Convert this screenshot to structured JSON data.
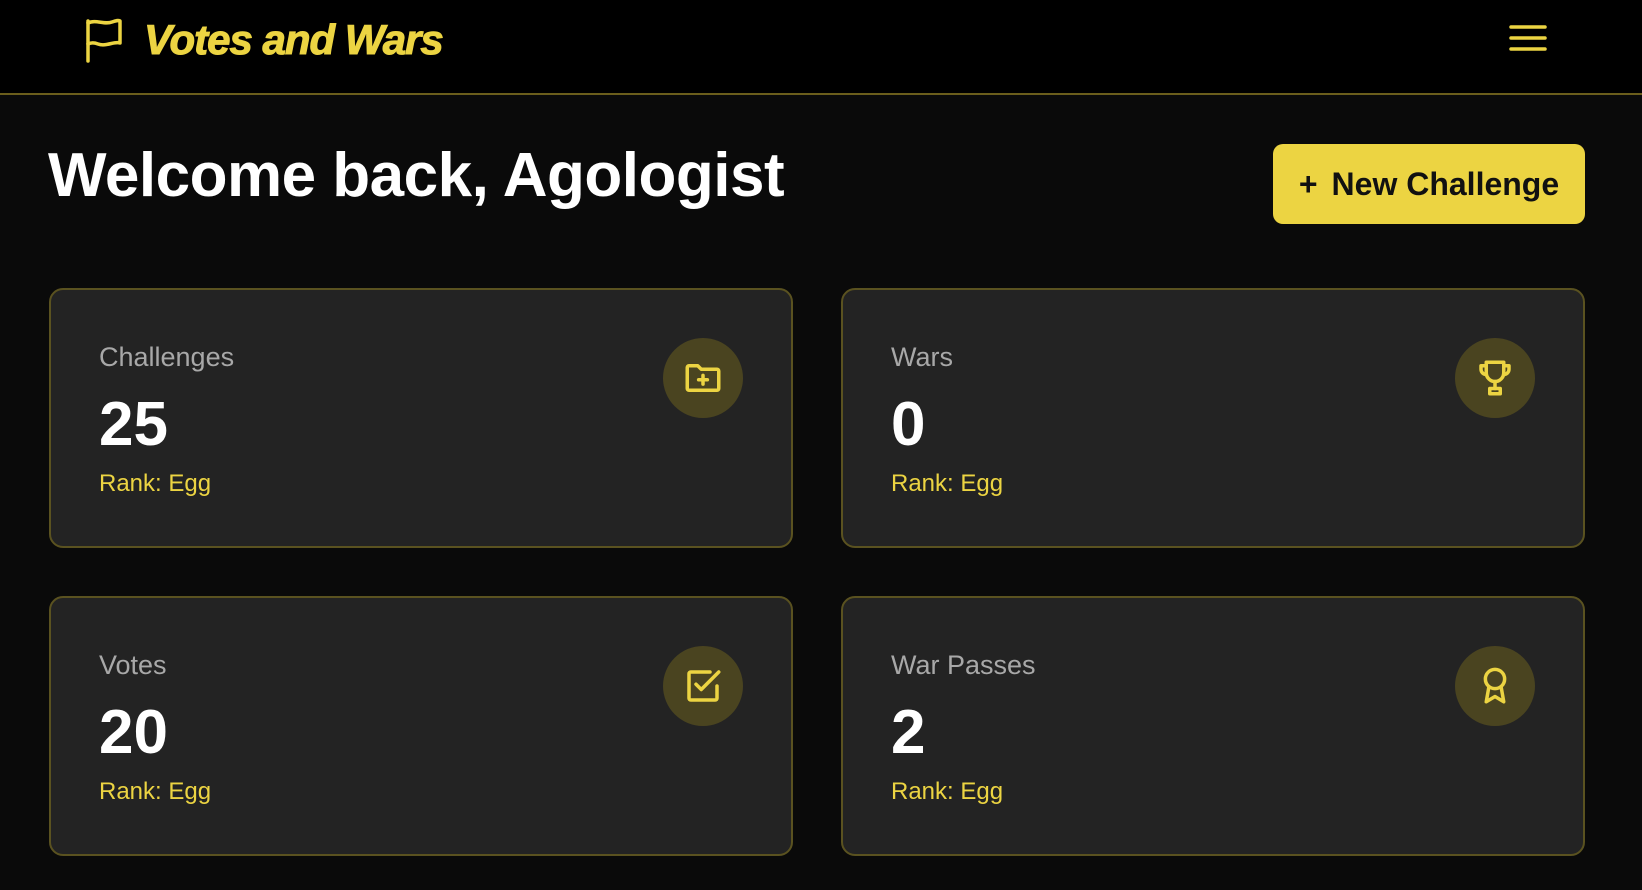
{
  "header": {
    "brand_title": "Votes and Wars",
    "brand_icon": "flag-icon",
    "menu_icon": "hamburger-menu-icon"
  },
  "main": {
    "title": "Welcome back, Agologist",
    "new_challenge_plus": "+",
    "new_challenge_label": "New Challenge"
  },
  "stats": [
    {
      "label": "Challenges",
      "value": "25",
      "rank": "Rank: Egg",
      "icon": "folder-plus-icon"
    },
    {
      "label": "Wars",
      "value": "0",
      "rank": "Rank: Egg",
      "icon": "trophy-icon"
    },
    {
      "label": "Votes",
      "value": "20",
      "rank": "Rank: Egg",
      "icon": "check-square-icon"
    },
    {
      "label": "War Passes",
      "value": "2",
      "rank": "Rank: Egg",
      "icon": "award-ribbon-icon"
    }
  ],
  "colors": {
    "accent": "#ecd442",
    "background": "#0a0a0a",
    "card_background": "#232323",
    "card_border": "#5a5220",
    "icon_circle": "#4a4420"
  }
}
